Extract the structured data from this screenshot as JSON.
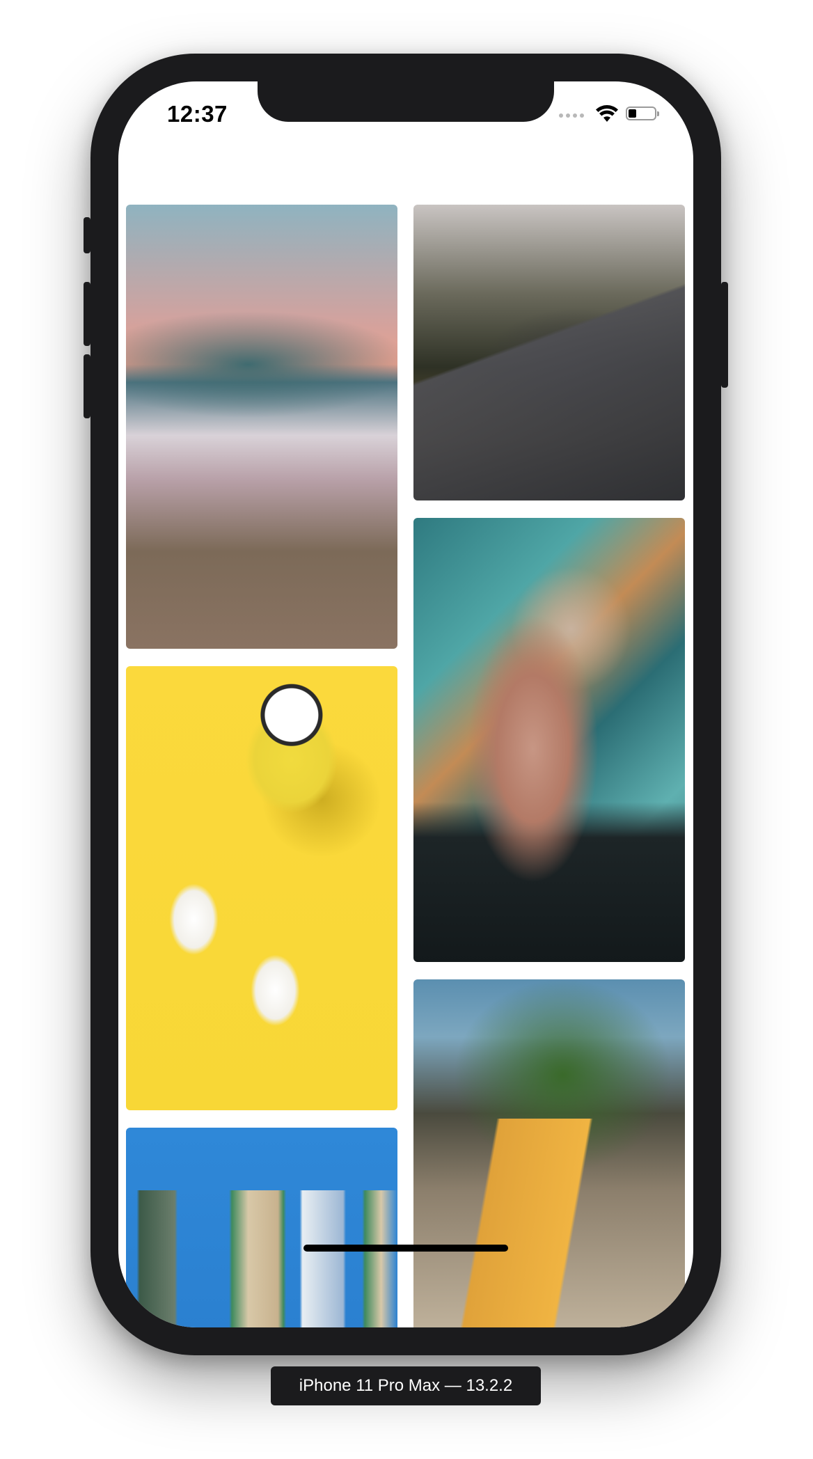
{
  "status_bar": {
    "time": "12:37",
    "battery_level": 0.3,
    "icons": [
      "cellular-signal-icon",
      "wifi-icon",
      "battery-icon"
    ]
  },
  "photos": [
    {
      "subject": "santorini-hillside-town-photo"
    },
    {
      "subject": "vintage-race-car-photo"
    },
    {
      "subject": "yellow-mug-and-eggs-photo"
    },
    {
      "subject": "woman-with-graffiti-backdrop-photo"
    },
    {
      "subject": "blue-building-windows-photo"
    },
    {
      "subject": "pina-colada-sign-photo"
    }
  ],
  "simulator_label": "iPhone 11 Pro Max — 13.2.2",
  "colors": {
    "device_frame": "#1b1b1d",
    "screen_background": "#ffffff"
  }
}
